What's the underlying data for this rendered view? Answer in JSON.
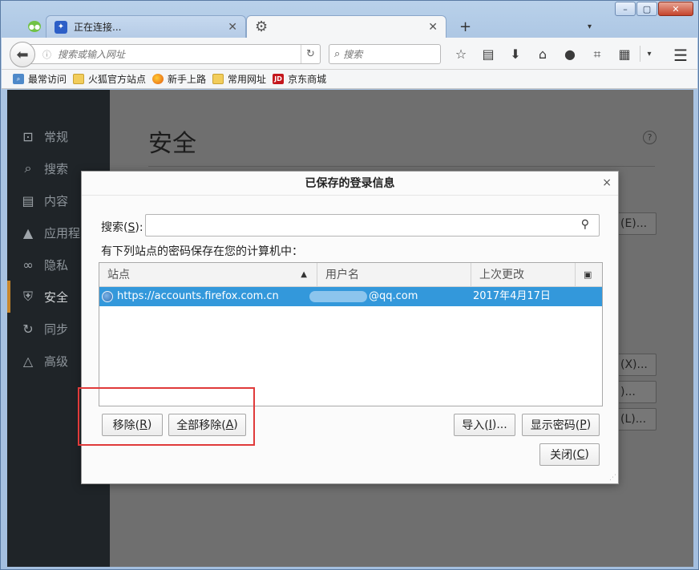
{
  "window": {
    "minimize_label": "–",
    "maximize_label": "▢",
    "close_label": "✕"
  },
  "tabs": [
    {
      "title": "正在连接...",
      "icon": "paw-icon",
      "close": "✕"
    },
    {
      "title": "",
      "icon": "gear-icon",
      "close": "✕"
    }
  ],
  "tab_new_label": "+",
  "tab_list_label": "▾",
  "navbar": {
    "url_placeholder": "搜索或输入网址",
    "search_placeholder": "搜索"
  },
  "bookmarks": [
    {
      "label": "最常访问",
      "icon": "mostvisited"
    },
    {
      "label": "火狐官方站点",
      "icon": "folder"
    },
    {
      "label": "新手上路",
      "icon": "firefox"
    },
    {
      "label": "常用网址",
      "icon": "folder"
    },
    {
      "label": "京东商城",
      "icon": "jd"
    }
  ],
  "sidebar": [
    {
      "label": "常规",
      "icon": "⊡"
    },
    {
      "label": "搜索",
      "icon": "⌕"
    },
    {
      "label": "内容",
      "icon": "▤"
    },
    {
      "label": "应用程",
      "icon": "▲"
    },
    {
      "label": "隐私",
      "icon": "∞"
    },
    {
      "label": "安全",
      "icon": "⛨"
    },
    {
      "label": "同步",
      "icon": "↻"
    },
    {
      "label": "高级",
      "icon": "△"
    }
  ],
  "prefs": {
    "title": "安全",
    "help": "?",
    "bg_btn_1": "(E)...",
    "bg_btn_2": "(X)...",
    "bg_btn_3": ")...",
    "bg_btn_4": "(L)..."
  },
  "dialog": {
    "title": "已保存的登录信息",
    "close": "×",
    "search_label_pre": "搜索(",
    "search_label_key": "S",
    "search_label_post": "):",
    "description": "有下列站点的密码保存在您的计算机中：",
    "columns": {
      "site": "站点",
      "username": "用户名",
      "last_changed": "上次更改"
    },
    "rows": [
      {
        "site": "https://accounts.firefox.com.cn",
        "username": "@qq.com",
        "last_changed": "2017年4月17日"
      }
    ],
    "buttons": {
      "remove": {
        "pre": "移除(",
        "key": "R",
        "post": ")"
      },
      "remove_all": {
        "pre": "全部移除(",
        "key": "A",
        "post": ")"
      },
      "import": {
        "pre": "导入(",
        "key": "I",
        "post": ")..."
      },
      "show_passwords": {
        "pre": "显示密码(",
        "key": "P",
        "post": ")"
      },
      "close": {
        "pre": "关闭(",
        "key": "C",
        "post": ")"
      }
    }
  },
  "colors": {
    "selection": "#3398db",
    "highlight_box": "#e03a3a",
    "sidebar_active": "#c8872d"
  }
}
